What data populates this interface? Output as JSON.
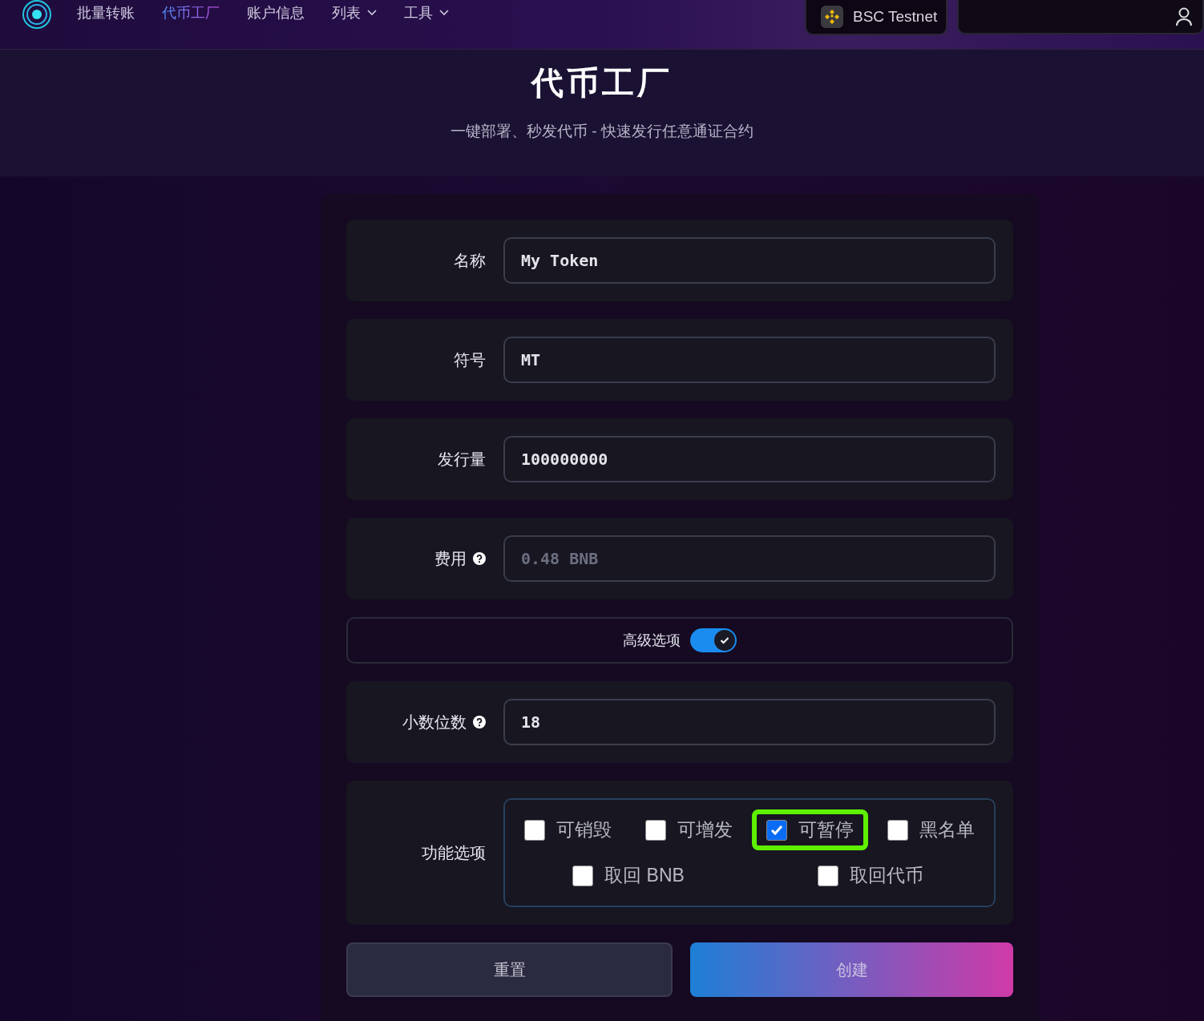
{
  "nav": {
    "items": [
      {
        "label": "批量转账",
        "selected": false,
        "dropdown": false
      },
      {
        "label": "代币工厂",
        "selected": true,
        "dropdown": false
      },
      {
        "label": "账户信息",
        "selected": false,
        "dropdown": false
      },
      {
        "label": "列表",
        "selected": false,
        "dropdown": true
      },
      {
        "label": "工具",
        "selected": false,
        "dropdown": true
      }
    ],
    "network": "BSC Testnet"
  },
  "header": {
    "title": "代币工厂",
    "subtitle": "一键部署、秒发代币 - 快速发行任意通证合约"
  },
  "form": {
    "rows": [
      {
        "kind": "field",
        "label": "名称",
        "value": "My Token",
        "help": false
      },
      {
        "kind": "field",
        "label": "符号",
        "value": "MT",
        "help": false
      },
      {
        "kind": "field",
        "label": "发行量",
        "value": "100000000",
        "help": false
      },
      {
        "kind": "field",
        "label": "费用",
        "placeholder": "0.48 BNB",
        "help": true
      },
      {
        "kind": "toggle",
        "label": "高级选项",
        "on": true
      },
      {
        "kind": "field",
        "label": "小数位数",
        "value": "18",
        "help": true
      },
      {
        "kind": "options",
        "label": "功能选项",
        "options": [
          {
            "label": "可销毁",
            "checked": false,
            "highlighted": false
          },
          {
            "label": "可增发",
            "checked": false,
            "highlighted": false
          },
          {
            "label": "可暂停",
            "checked": true,
            "highlighted": true
          },
          {
            "label": "黑名单",
            "checked": false,
            "highlighted": false
          },
          {
            "label": "取回 BNB",
            "checked": false,
            "highlighted": false
          },
          {
            "label": "取回代币",
            "checked": false,
            "highlighted": false
          }
        ]
      }
    ],
    "buttons": [
      {
        "kind": "secondary",
        "label": "重置"
      },
      {
        "kind": "primary",
        "label": "创建"
      }
    ]
  }
}
